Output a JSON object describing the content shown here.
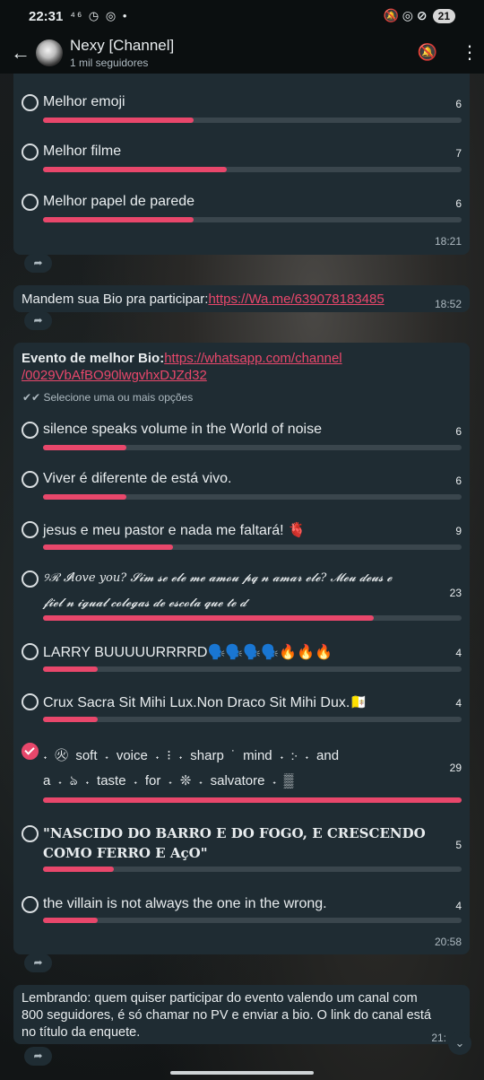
{
  "status_bar": {
    "time": "22:31",
    "notif_icons": "⁴⁶ ◷ ◎ •",
    "right_icons": "🔕 ◎ ⊘",
    "battery": "21"
  },
  "app_bar": {
    "title": "Nexy [Channel]",
    "subtitle": "1 mil seguidores"
  },
  "poll1": {
    "options": [
      {
        "label": "Melhor emoji",
        "count": "6",
        "fraction": 0.36
      },
      {
        "label": "Melhor filme",
        "count": "7",
        "fraction": 0.44
      },
      {
        "label": "Melhor papel de parede",
        "count": "6",
        "fraction": 0.36
      }
    ],
    "time": "18:21"
  },
  "message1": {
    "text": "Mandem sua Bio pra participar:",
    "link": "https://Wa.me/639078183485",
    "time": "18:52"
  },
  "poll2": {
    "title": "Evento de melhor Bio:",
    "link_line1": "https://whatsapp.com/channel",
    "link_line2": "/0029VbAfBO90lwgvhxDJZd32",
    "hint": "Selecione uma ou mais opções",
    "options": [
      {
        "label": "silence speaks volume in the World of noise",
        "count": "6",
        "fraction": 0.2,
        "checked": false
      },
      {
        "label": "Viver é diferente de está vivo.",
        "count": "6",
        "fraction": 0.2,
        "checked": false
      },
      {
        "label": "jesus e meu pastor e nada me faltará! 🫀",
        "count": "9",
        "fraction": 0.31,
        "checked": false
      },
      {
        "label_line1": "୨ℛ 𝓘love you? 𝓢𝓲𝓶 𝓼𝓮 𝓮𝓵𝓮 𝓶𝓮 𝓪𝓶𝓸𝓾 𝓹𝓺 𝓷 𝓪𝓶𝓪𝓻 𝓮𝓵𝓮? 𝓜𝓮𝓾 𝓭𝓮𝓾𝓼 𝓮",
        "label_line2": "𝓯𝓲𝓮𝓵 𝓷 𝓲𝓰𝓾𝓪𝓵 𝓬𝓸𝓵𝓮𝓰𝓪𝓼 𝓭𝓮 𝓮𝓼𝓬𝓸𝓵𝓪 𝓺𝓾𝓮 𝓽𝓮 𝓭",
        "count": "23",
        "fraction": 0.79,
        "checked": false
      },
      {
        "label": "LARRY BUUUUURRRRD🗣️🗣️🗣️🗣️🔥🔥🔥",
        "count": "4",
        "fraction": 0.13,
        "checked": false
      },
      {
        "label": "Crux Sacra Sit Mihi Lux.Non Draco Sit Mihi Dux.🇻🇦",
        "count": "4",
        "fraction": 0.13,
        "checked": false
      },
      {
        "label_line1": "˖ ㊋ soft ˖ voice ˖ ⁝ ˖ sharp ˙ mind ˖ ჻ ˖ and",
        "label_line2": "a ˖ ঌ ˖ taste ˖ for ˖ ❊ ˖ salvatore ˖ ▒",
        "count": "29",
        "fraction": 1.0,
        "checked": true
      },
      {
        "label_line1": "\"NASCIDO DO BARRO E DO FOGO, E CRESCENDO",
        "label_line2": "COMO FERRO E AçO\"",
        "count": "5",
        "fraction": 0.17,
        "checked": false
      },
      {
        "label": "the villain is not always the one in the wrong.",
        "count": "4",
        "fraction": 0.13,
        "checked": false
      }
    ],
    "time": "20:58"
  },
  "message2": {
    "line1": "Lembrando: quem quiser participar do evento valendo um canal com",
    "line2": "800 seguidores, é só chamar no PV e enviar a bio. O link do canal está",
    "line3": "no título da enquete.",
    "time": "21:"
  },
  "forward_icon": "share-forward-icon",
  "colors": {
    "accent": "#e8476b",
    "bubble": "#1f2c33",
    "track": "#3a464d",
    "text": "#e9edef",
    "muted": "#aebac1"
  }
}
